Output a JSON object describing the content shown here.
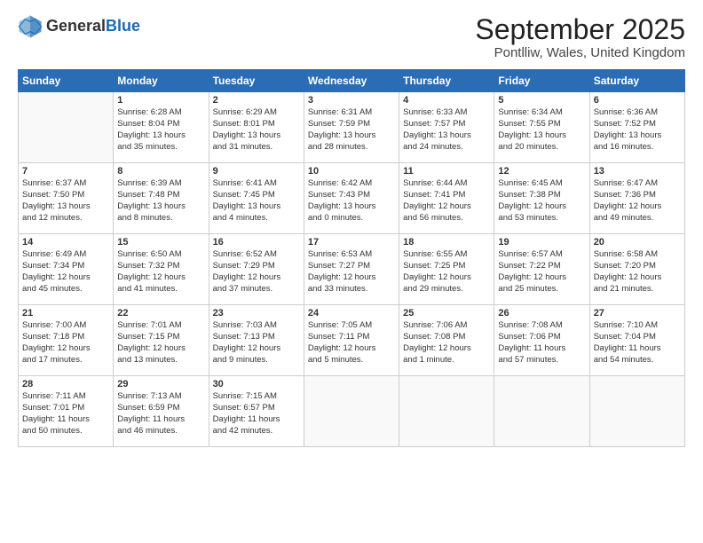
{
  "header": {
    "logo_general": "General",
    "logo_blue": "Blue",
    "month_title": "September 2025",
    "location": "Pontlliw, Wales, United Kingdom"
  },
  "days_of_week": [
    "Sunday",
    "Monday",
    "Tuesday",
    "Wednesday",
    "Thursday",
    "Friday",
    "Saturday"
  ],
  "weeks": [
    [
      {
        "day": "",
        "info": ""
      },
      {
        "day": "1",
        "info": "Sunrise: 6:28 AM\nSunset: 8:04 PM\nDaylight: 13 hours\nand 35 minutes."
      },
      {
        "day": "2",
        "info": "Sunrise: 6:29 AM\nSunset: 8:01 PM\nDaylight: 13 hours\nand 31 minutes."
      },
      {
        "day": "3",
        "info": "Sunrise: 6:31 AM\nSunset: 7:59 PM\nDaylight: 13 hours\nand 28 minutes."
      },
      {
        "day": "4",
        "info": "Sunrise: 6:33 AM\nSunset: 7:57 PM\nDaylight: 13 hours\nand 24 minutes."
      },
      {
        "day": "5",
        "info": "Sunrise: 6:34 AM\nSunset: 7:55 PM\nDaylight: 13 hours\nand 20 minutes."
      },
      {
        "day": "6",
        "info": "Sunrise: 6:36 AM\nSunset: 7:52 PM\nDaylight: 13 hours\nand 16 minutes."
      }
    ],
    [
      {
        "day": "7",
        "info": "Sunrise: 6:37 AM\nSunset: 7:50 PM\nDaylight: 13 hours\nand 12 minutes."
      },
      {
        "day": "8",
        "info": "Sunrise: 6:39 AM\nSunset: 7:48 PM\nDaylight: 13 hours\nand 8 minutes."
      },
      {
        "day": "9",
        "info": "Sunrise: 6:41 AM\nSunset: 7:45 PM\nDaylight: 13 hours\nand 4 minutes."
      },
      {
        "day": "10",
        "info": "Sunrise: 6:42 AM\nSunset: 7:43 PM\nDaylight: 13 hours\nand 0 minutes."
      },
      {
        "day": "11",
        "info": "Sunrise: 6:44 AM\nSunset: 7:41 PM\nDaylight: 12 hours\nand 56 minutes."
      },
      {
        "day": "12",
        "info": "Sunrise: 6:45 AM\nSunset: 7:38 PM\nDaylight: 12 hours\nand 53 minutes."
      },
      {
        "day": "13",
        "info": "Sunrise: 6:47 AM\nSunset: 7:36 PM\nDaylight: 12 hours\nand 49 minutes."
      }
    ],
    [
      {
        "day": "14",
        "info": "Sunrise: 6:49 AM\nSunset: 7:34 PM\nDaylight: 12 hours\nand 45 minutes."
      },
      {
        "day": "15",
        "info": "Sunrise: 6:50 AM\nSunset: 7:32 PM\nDaylight: 12 hours\nand 41 minutes."
      },
      {
        "day": "16",
        "info": "Sunrise: 6:52 AM\nSunset: 7:29 PM\nDaylight: 12 hours\nand 37 minutes."
      },
      {
        "day": "17",
        "info": "Sunrise: 6:53 AM\nSunset: 7:27 PM\nDaylight: 12 hours\nand 33 minutes."
      },
      {
        "day": "18",
        "info": "Sunrise: 6:55 AM\nSunset: 7:25 PM\nDaylight: 12 hours\nand 29 minutes."
      },
      {
        "day": "19",
        "info": "Sunrise: 6:57 AM\nSunset: 7:22 PM\nDaylight: 12 hours\nand 25 minutes."
      },
      {
        "day": "20",
        "info": "Sunrise: 6:58 AM\nSunset: 7:20 PM\nDaylight: 12 hours\nand 21 minutes."
      }
    ],
    [
      {
        "day": "21",
        "info": "Sunrise: 7:00 AM\nSunset: 7:18 PM\nDaylight: 12 hours\nand 17 minutes."
      },
      {
        "day": "22",
        "info": "Sunrise: 7:01 AM\nSunset: 7:15 PM\nDaylight: 12 hours\nand 13 minutes."
      },
      {
        "day": "23",
        "info": "Sunrise: 7:03 AM\nSunset: 7:13 PM\nDaylight: 12 hours\nand 9 minutes."
      },
      {
        "day": "24",
        "info": "Sunrise: 7:05 AM\nSunset: 7:11 PM\nDaylight: 12 hours\nand 5 minutes."
      },
      {
        "day": "25",
        "info": "Sunrise: 7:06 AM\nSunset: 7:08 PM\nDaylight: 12 hours\nand 1 minute."
      },
      {
        "day": "26",
        "info": "Sunrise: 7:08 AM\nSunset: 7:06 PM\nDaylight: 11 hours\nand 57 minutes."
      },
      {
        "day": "27",
        "info": "Sunrise: 7:10 AM\nSunset: 7:04 PM\nDaylight: 11 hours\nand 54 minutes."
      }
    ],
    [
      {
        "day": "28",
        "info": "Sunrise: 7:11 AM\nSunset: 7:01 PM\nDaylight: 11 hours\nand 50 minutes."
      },
      {
        "day": "29",
        "info": "Sunrise: 7:13 AM\nSunset: 6:59 PM\nDaylight: 11 hours\nand 46 minutes."
      },
      {
        "day": "30",
        "info": "Sunrise: 7:15 AM\nSunset: 6:57 PM\nDaylight: 11 hours\nand 42 minutes."
      },
      {
        "day": "",
        "info": ""
      },
      {
        "day": "",
        "info": ""
      },
      {
        "day": "",
        "info": ""
      },
      {
        "day": "",
        "info": ""
      }
    ]
  ]
}
